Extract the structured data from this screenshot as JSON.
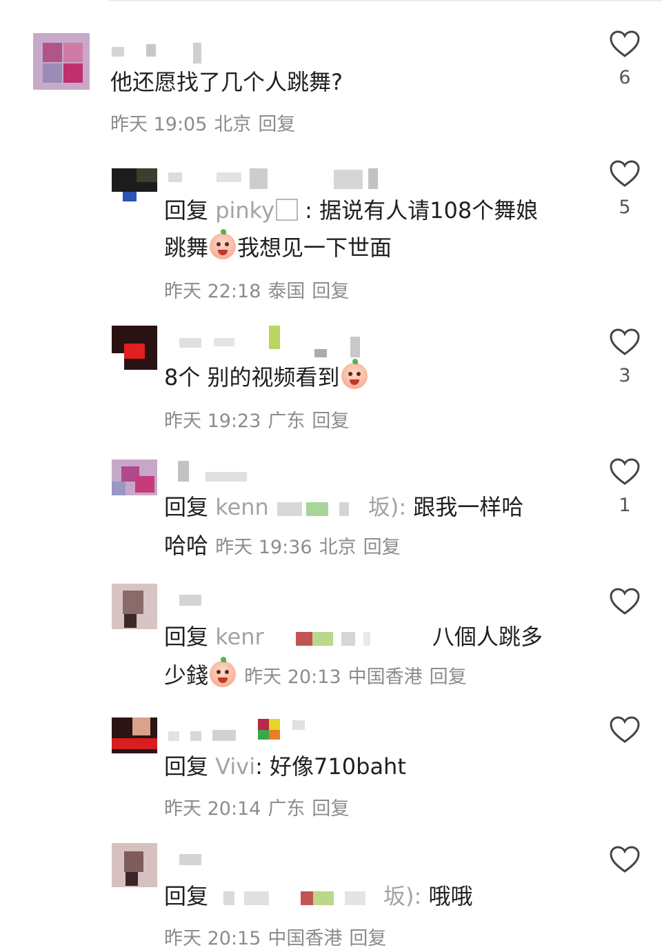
{
  "comments": [
    {
      "body": "他还愿找了几个人跳舞?",
      "time": "昨天 19:05",
      "location": "北京",
      "reply_label": "回复",
      "likes": "6"
    },
    {
      "reply_prefix": "回复",
      "reply_to": "pinky",
      "sep": ":",
      "line1": "据说有人请108个舞娘",
      "line2a": "跳舞",
      "line2b": "我想见一下世面",
      "time": "昨天 22:18",
      "location": "泰国",
      "reply_label": "回复",
      "likes": "5"
    },
    {
      "body_a": "8个 别的视频看到",
      "time": "昨天 19:23",
      "location": "广东",
      "reply_label": "回复",
      "likes": "3"
    },
    {
      "reply_prefix": "回复",
      "reply_to": "kenn",
      "tail": "坂):",
      "line1": "跟我一样哈",
      "line2": "哈哈",
      "time": "昨天 19:36",
      "location": "北京",
      "reply_label": "回复",
      "likes": "1"
    },
    {
      "reply_prefix": "回复",
      "reply_to": "kenr",
      "line1": "八個人跳多",
      "line2": "少錢",
      "time": "昨天 20:13",
      "location": "中国香港",
      "reply_label": "回复",
      "likes": ""
    },
    {
      "reply_prefix": "回复",
      "reply_to": "Vivi",
      "sep": ":",
      "line1": "好像710baht",
      "time": "昨天 20:14",
      "location": "广东",
      "reply_label": "回复",
      "likes": ""
    },
    {
      "reply_prefix": "回复",
      "tail": "坂):",
      "line1": "哦哦",
      "time": "昨天 20:15",
      "location": "中国香港",
      "reply_label": "回复",
      "likes": ""
    }
  ],
  "icons": {
    "like": "heart-outline-icon",
    "emoji": "peach-emoji-icon"
  },
  "colors": {
    "text": "#1f1f1f",
    "meta": "#8c8c8c",
    "reply_name": "#a3a3a3",
    "heart": "#444444"
  }
}
